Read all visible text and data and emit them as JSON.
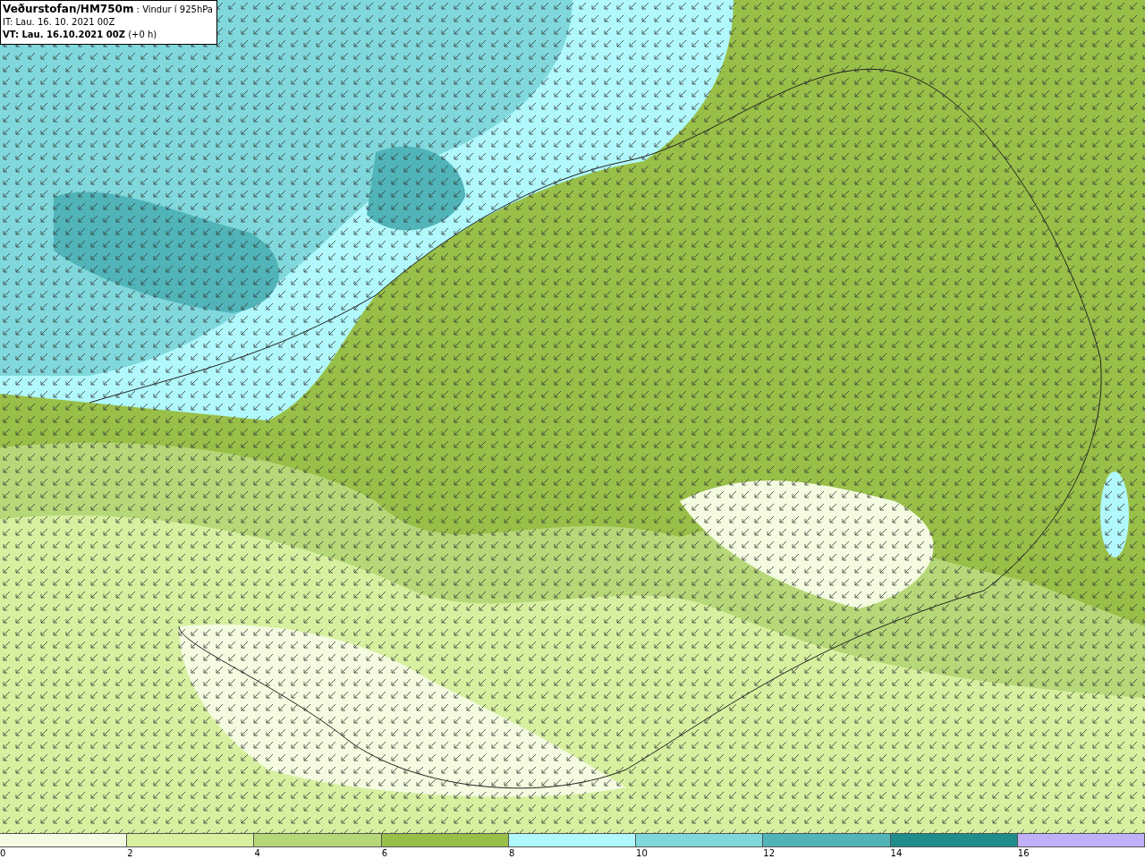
{
  "title_box": {
    "source": "Veðurstofan/HM750m",
    "field": ": Vindur í 925hPa",
    "init_time": "IT: Lau. 16. 10. 2021 00Z",
    "valid_time": "VT: Lau. 16.10.2021 00Z",
    "lead": "(+0 h)"
  },
  "legend": {
    "bins": [
      {
        "color": "#f4fbe0"
      },
      {
        "color": "#d6f0a0"
      },
      {
        "color": "#b6d878"
      },
      {
        "color": "#98bf48"
      },
      {
        "color": "#b0f8fc"
      },
      {
        "color": "#80d8dc"
      },
      {
        "color": "#50b4b8"
      },
      {
        "color": "#208c8c"
      },
      {
        "color": "#c0b0f8"
      }
    ],
    "ticks": [
      "0",
      "2",
      "4",
      "6",
      "8",
      "10",
      "12",
      "14",
      "16"
    ]
  }
}
